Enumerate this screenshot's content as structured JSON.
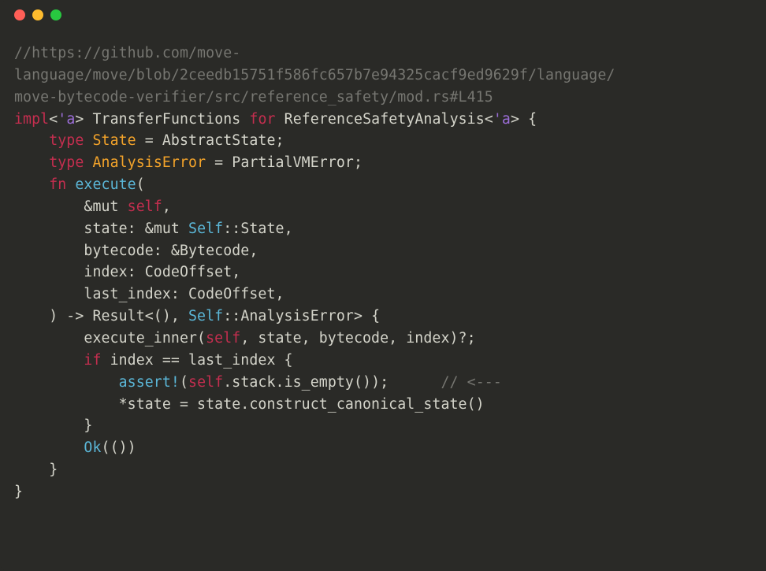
{
  "comment_line_1": "//https://github.com/move-",
  "comment_line_2": "language/move/blob/2ceedb15751f586fc657b7e94325cacf9ed9629f/language/",
  "comment_line_3": "move-bytecode-verifier/src/reference_safety/mod.rs#L415",
  "kw_impl": "impl",
  "lt_open": "<",
  "purple_a": "'a",
  "gt_close": ">",
  "ty_transfer_functions": "TransferFunctions",
  "kw_for": "for",
  "ty_reference_safety": "ReferenceSafetyAnalysis",
  "lt_open2": "<",
  "purple_a2": "'a",
  "gt_close2": ">",
  "brace_open": " {",
  "kw_type1": "type",
  "ty_state": "State",
  "eq1": " = ",
  "ty_abstract_state": "AbstractState",
  "semi1": ";",
  "kw_type2": "type",
  "ty_analysis_error": "AnalysisError",
  "eq2": " = ",
  "ty_partial_vm_error": "PartialVMError",
  "semi2": ";",
  "kw_fn": "fn",
  "fn_execute": "execute",
  "paren_open": "(",
  "amp_mut_self": "&mut ",
  "self1": "self",
  "comma1": ",",
  "param_state": "state: ",
  "amp_mut2": "&mut ",
  "self_ty1": "Self",
  "dcolon1": "::",
  "state_assoc": "State",
  "comma2": ",",
  "param_bytecode": "bytecode: &Bytecode,",
  "param_index": "index: CodeOffset,",
  "param_last_index": "last_index: CodeOffset,",
  "paren_close_arrow": ") -> Result<(), ",
  "self_ty2": "Self",
  "dcolon2": "::",
  "analysis_err_assoc": "AnalysisError",
  "result_tail": "> {",
  "exec_inner_pre": "execute_inner(",
  "self2": "self",
  "exec_inner_post": ", state, bytecode, index)?;",
  "kw_if": "if",
  "if_cond": " index == last_index {",
  "assert_fn": "assert!",
  "assert_open": "(",
  "self3": "self",
  "assert_post": ".stack.is_empty());",
  "assert_comment": "// <---",
  "assert_gap": "      ",
  "star_state_line": "*state = state.construct_canonical_state()",
  "close_if": "}",
  "ok_call": "Ok",
  "ok_parens": "(())",
  "close_fn": "}",
  "close_impl": "}",
  "indent1": "    ",
  "indent2": "        ",
  "indent3": "            ",
  "space": " "
}
